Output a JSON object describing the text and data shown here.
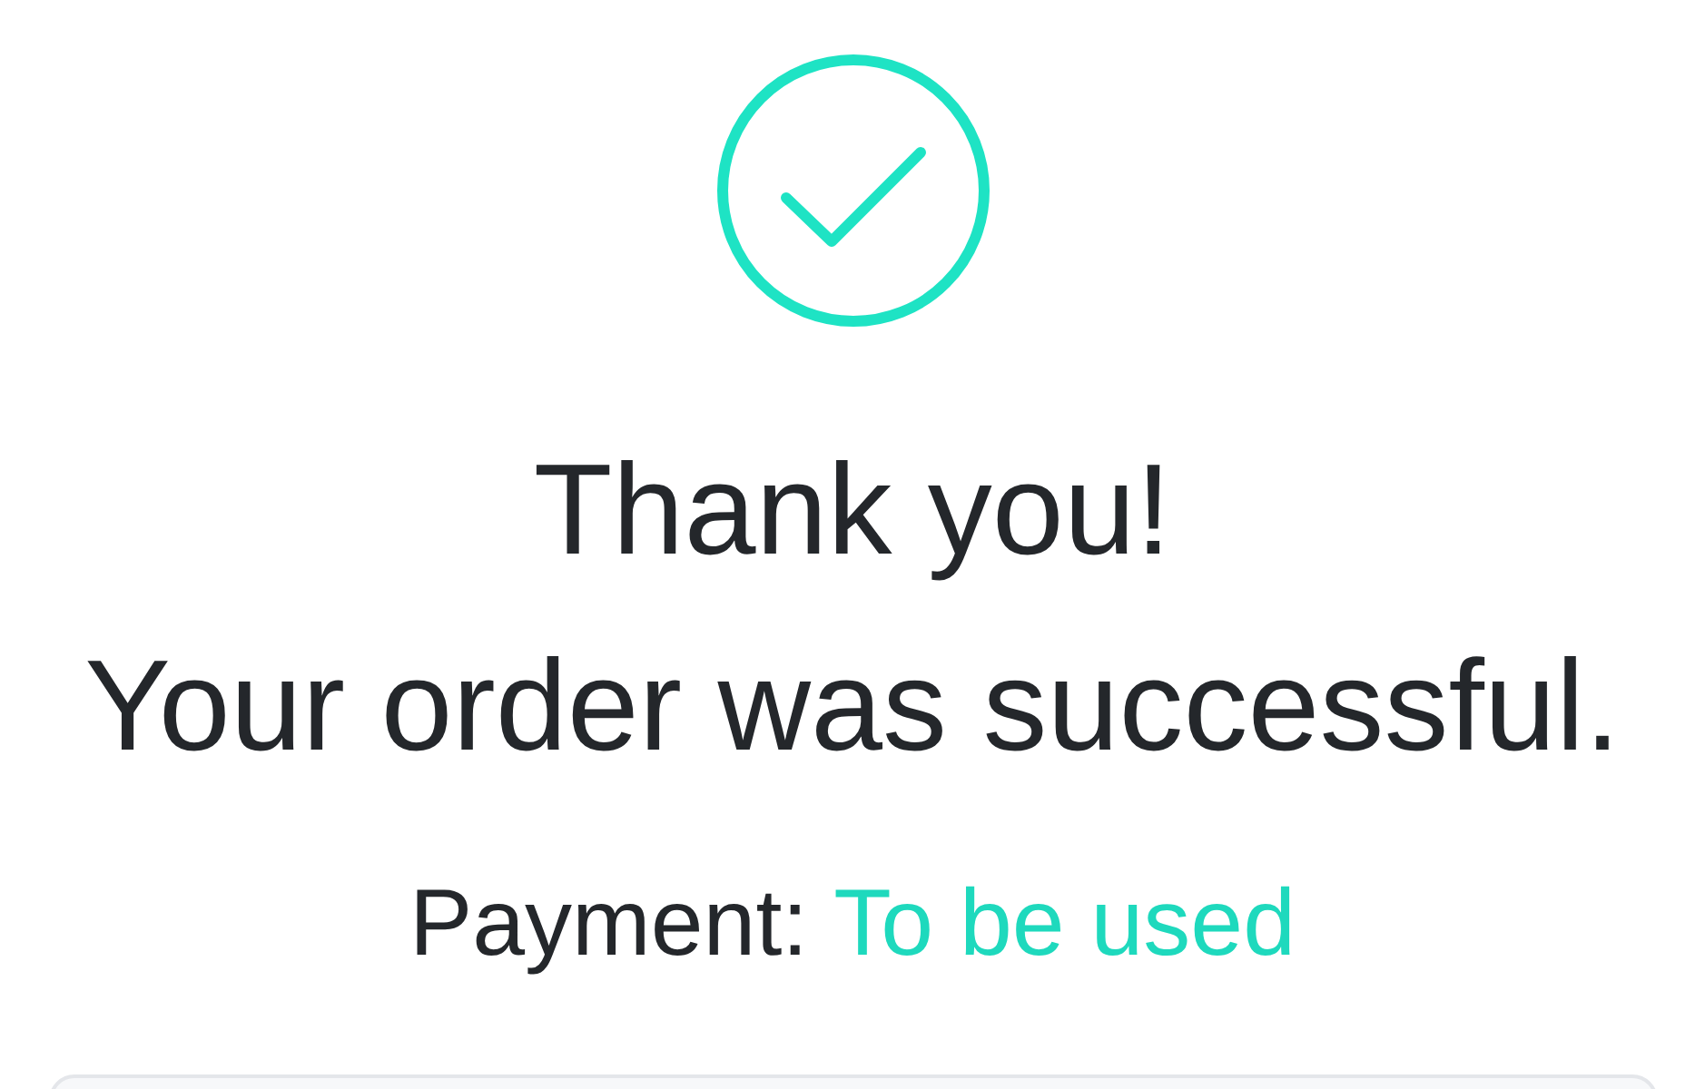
{
  "heading": "Thank you!",
  "message": "Your order was successful.",
  "payment": {
    "label": "Payment:",
    "value": "To be used"
  }
}
